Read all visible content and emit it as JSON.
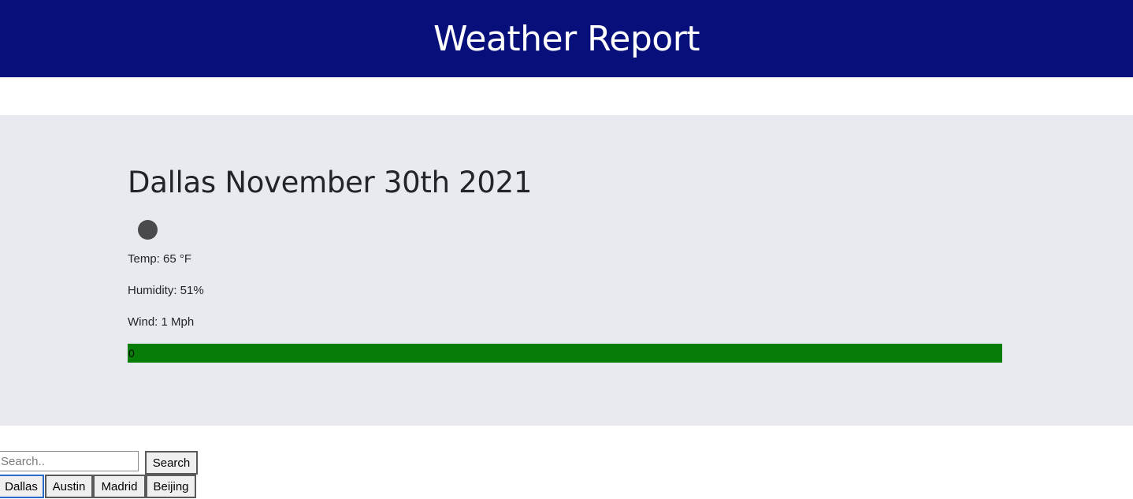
{
  "header": {
    "title": "Weather Report"
  },
  "current": {
    "city_date": "Dallas November 30th 2021",
    "icon": "weather-circle-icon",
    "temp": "Temp: 65 °F",
    "humidity": "Humidity: 51%",
    "wind": "Wind: 1 Mph",
    "uv_index": "0",
    "uv_fill_fraction": 1.0,
    "uv_color": "#067d06"
  },
  "search": {
    "placeholder": "Search..",
    "button_label": "Search"
  },
  "history": [
    {
      "label": "Dallas"
    },
    {
      "label": "Austin"
    },
    {
      "label": "Madrid"
    },
    {
      "label": "Beijing"
    }
  ],
  "colors": {
    "header_bg": "#07107a",
    "panel_bg": "#e9eaef"
  }
}
